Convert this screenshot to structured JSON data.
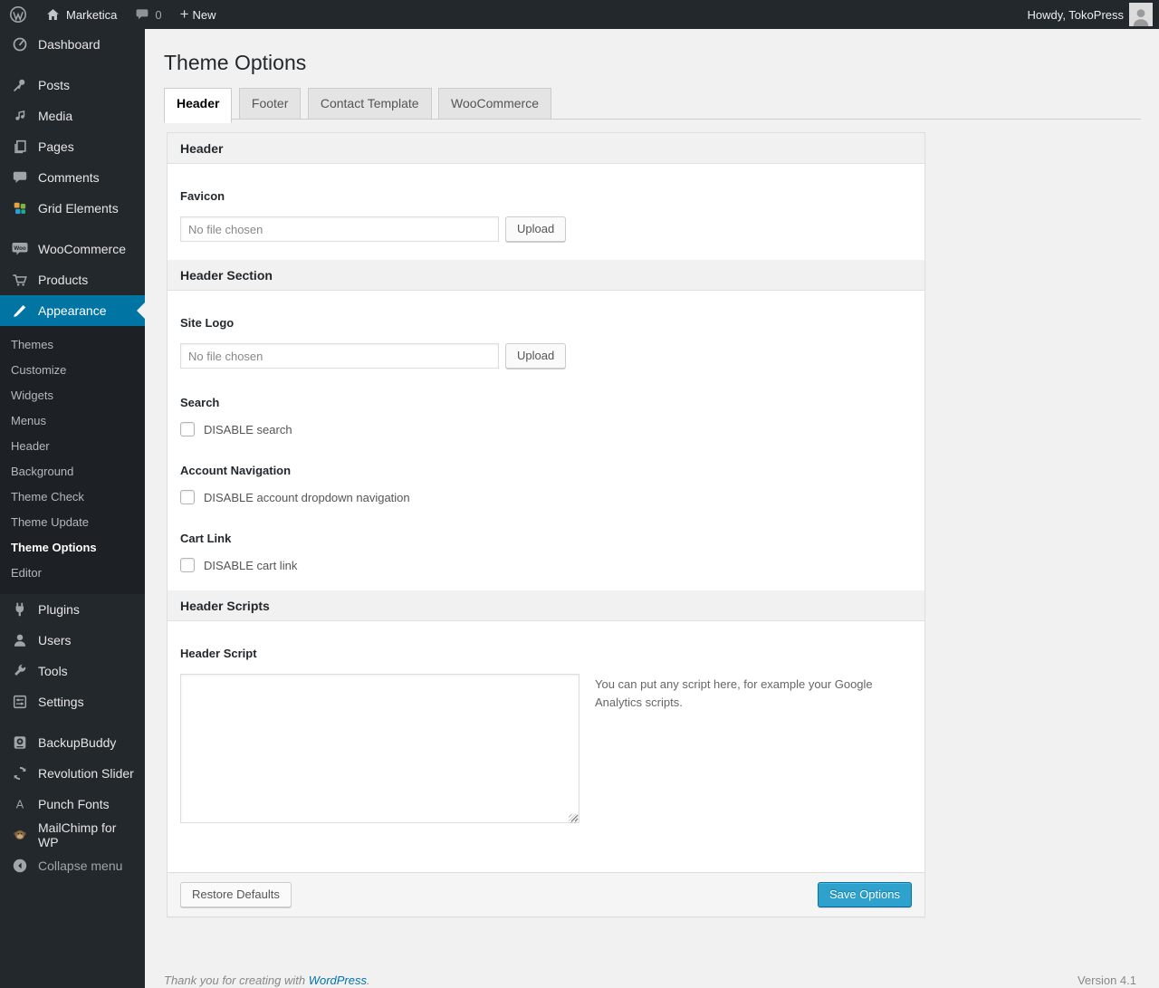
{
  "admin_bar": {
    "site_name": "Marketica",
    "comments_count": "0",
    "new_label": "New",
    "howdy": "Howdy, TokoPress"
  },
  "sidebar": {
    "items": [
      {
        "label": "Dashboard",
        "icon": "dashboard-icon"
      },
      {
        "label": "Posts",
        "icon": "pushpin-icon"
      },
      {
        "label": "Media",
        "icon": "media-icon"
      },
      {
        "label": "Pages",
        "icon": "pages-icon"
      },
      {
        "label": "Comments",
        "icon": "comments-icon"
      },
      {
        "label": "Grid Elements",
        "icon": "grid-elements-icon"
      },
      {
        "label": "WooCommerce",
        "icon": "woocommerce-icon"
      },
      {
        "label": "Products",
        "icon": "cart-icon"
      },
      {
        "label": "Appearance",
        "icon": "appearance-brush-icon",
        "active": true
      },
      {
        "label": "Plugins",
        "icon": "plugin-icon"
      },
      {
        "label": "Users",
        "icon": "users-icon"
      },
      {
        "label": "Tools",
        "icon": "wrench-icon"
      },
      {
        "label": "Settings",
        "icon": "settings-icon"
      },
      {
        "label": "BackupBuddy",
        "icon": "backupbuddy-icon"
      },
      {
        "label": "Revolution Slider",
        "icon": "revolution-slider-icon"
      },
      {
        "label": "Punch Fonts",
        "icon": "punch-fonts-icon"
      },
      {
        "label": "MailChimp for WP",
        "icon": "mailchimp-icon"
      }
    ],
    "appearance_submenu": [
      {
        "label": "Themes",
        "current": false
      },
      {
        "label": "Customize",
        "current": false
      },
      {
        "label": "Widgets",
        "current": false
      },
      {
        "label": "Menus",
        "current": false
      },
      {
        "label": "Header",
        "current": false
      },
      {
        "label": "Background",
        "current": false
      },
      {
        "label": "Theme Check",
        "current": false
      },
      {
        "label": "Theme Update",
        "current": false
      },
      {
        "label": "Theme Options",
        "current": true
      },
      {
        "label": "Editor",
        "current": false
      }
    ],
    "collapse_label": "Collapse menu"
  },
  "page": {
    "title": "Theme Options",
    "tabs": [
      {
        "label": "Header",
        "active": true
      },
      {
        "label": "Footer",
        "active": false
      },
      {
        "label": "Contact Template",
        "active": false
      },
      {
        "label": "WooCommerce",
        "active": false
      }
    ]
  },
  "panel": {
    "header_section_title": "Header",
    "favicon": {
      "label": "Favicon",
      "file_placeholder": "No file chosen",
      "upload_label": "Upload"
    },
    "header_section2_title": "Header Section",
    "site_logo": {
      "label": "Site Logo",
      "file_placeholder": "No file chosen",
      "upload_label": "Upload"
    },
    "search": {
      "label": "Search",
      "checkbox_label": "DISABLE search",
      "checked": false
    },
    "account_navigation": {
      "label": "Account Navigation",
      "checkbox_label": "DISABLE account dropdown navigation",
      "checked": false
    },
    "cart_link": {
      "label": "Cart Link",
      "checkbox_label": "DISABLE cart link",
      "checked": false
    },
    "header_scripts_title": "Header Scripts",
    "header_script": {
      "label": "Header Script",
      "value": "",
      "note": "You can put any script here, for example your Google Analytics scripts."
    },
    "footer": {
      "restore_label": "Restore Defaults",
      "save_label": "Save Options"
    }
  },
  "page_footer": {
    "thanks_text": "Thank you for creating with ",
    "wordpress_link": "WordPress",
    "period": ".",
    "version": "Version 4.1"
  },
  "colors": {
    "accent_blue": "#0074a2",
    "primary_button": "#2ea2cc",
    "admin_bar_bg": "#23282d",
    "menu_bg": "#23282d",
    "submenu_bg": "#1d2125",
    "page_bg": "#f1f1f1",
    "link": "#0073aa"
  }
}
